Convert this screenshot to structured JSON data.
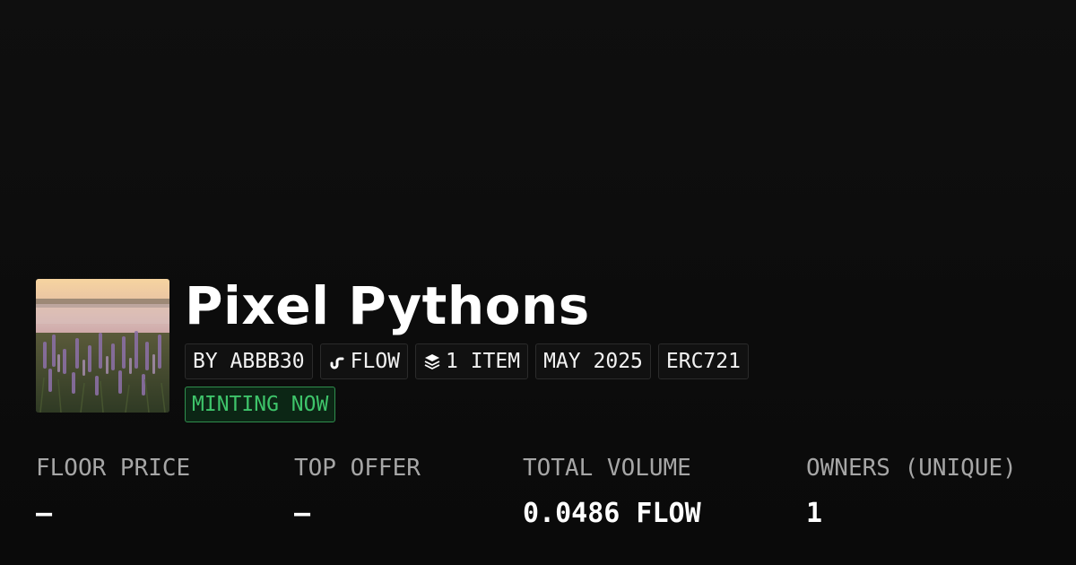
{
  "collection": {
    "name": "Pixel Pythons",
    "tags": [
      {
        "label": "BY ABBB30",
        "icon": ""
      },
      {
        "label": "FLOW",
        "icon": "flow-logo-icon"
      },
      {
        "label": "1 ITEM",
        "icon": "layers-icon"
      },
      {
        "label": "MAY 2025",
        "icon": ""
      },
      {
        "label": "ERC721",
        "icon": ""
      }
    ],
    "status": "MINTING NOW"
  },
  "stats": [
    {
      "label": "FLOOR PRICE",
      "value": "—"
    },
    {
      "label": "TOP OFFER",
      "value": "—"
    },
    {
      "label": "TOTAL VOLUME",
      "value": "0.0486 FLOW"
    },
    {
      "label": "OWNERS (UNIQUE)",
      "value": "1"
    }
  ],
  "colors": {
    "background": "#0a0a0a",
    "status_green": "#3ec46a",
    "muted_label": "#a6a6a6"
  }
}
